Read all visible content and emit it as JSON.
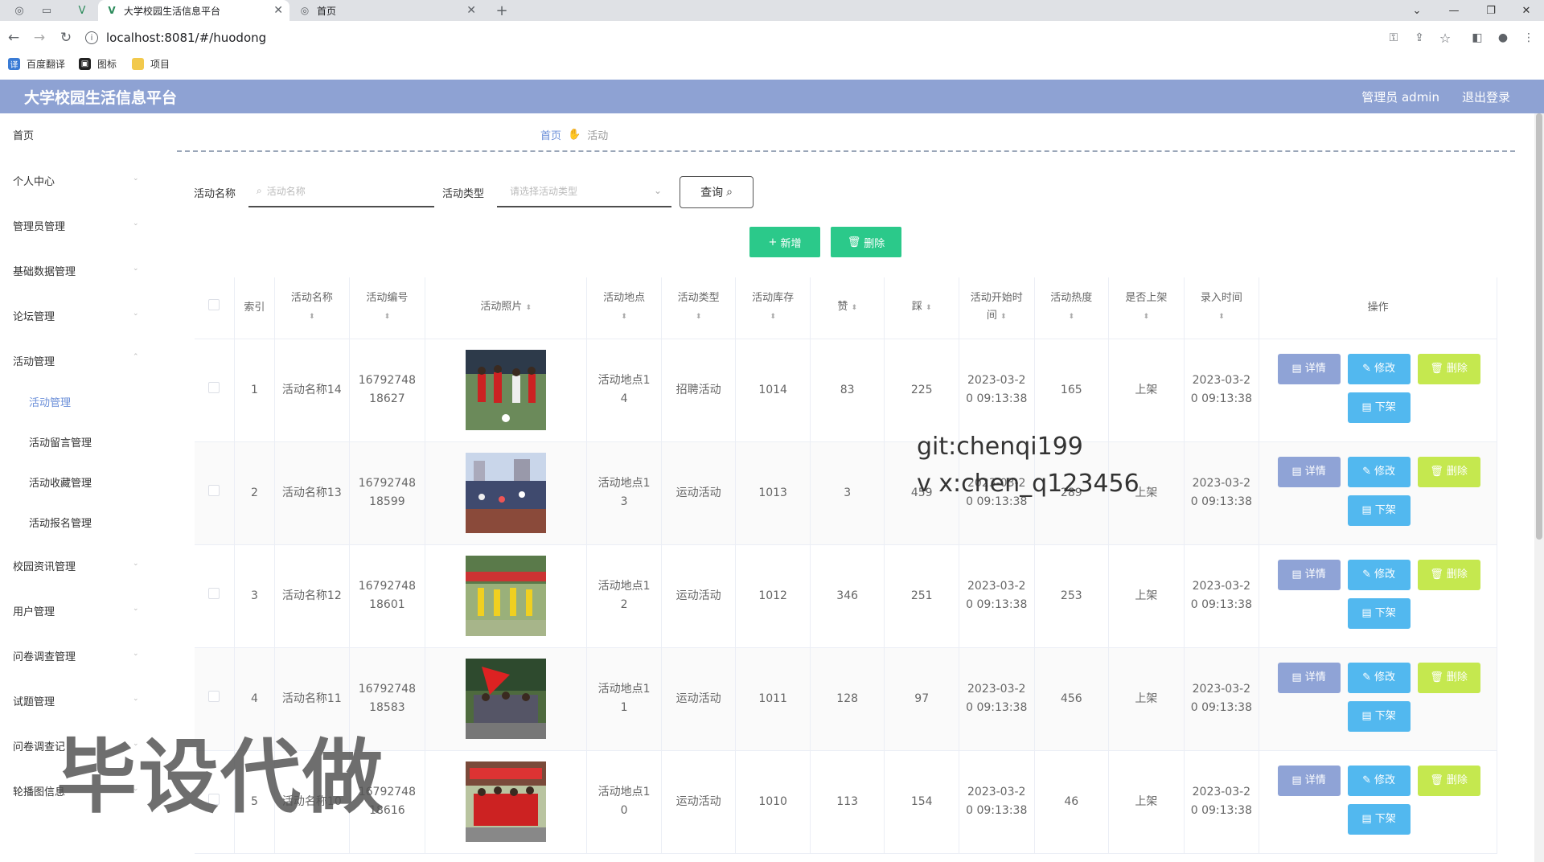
{
  "browser": {
    "tabs": [
      {
        "title": "大学校园生活信息平台"
      },
      {
        "title": "首页"
      }
    ],
    "url": "localhost:8081/#/huodong",
    "bookmarks": [
      "百度翻译",
      "图标",
      "项目"
    ]
  },
  "header": {
    "title": "大学校园生活信息平台",
    "admin": "管理员 admin",
    "logout": "退出登录"
  },
  "sidebar": {
    "items": [
      {
        "label": "首页"
      },
      {
        "label": "个人中心"
      },
      {
        "label": "管理员管理"
      },
      {
        "label": "基础数据管理"
      },
      {
        "label": "论坛管理"
      },
      {
        "label": "活动管理"
      },
      {
        "label": "校园资讯管理"
      },
      {
        "label": "用户管理"
      },
      {
        "label": "问卷调查管理"
      },
      {
        "label": "试题管理"
      },
      {
        "label": "问卷调查记"
      },
      {
        "label": "轮播图信息"
      }
    ],
    "subitems": [
      {
        "label": "活动管理"
      },
      {
        "label": "活动留言管理"
      },
      {
        "label": "活动收藏管理"
      },
      {
        "label": "活动报名管理"
      }
    ]
  },
  "breadcrumb": {
    "home": "首页",
    "current": "活动"
  },
  "filters": {
    "name_label": "活动名称",
    "name_placeholder": "活动名称",
    "type_label": "活动类型",
    "type_placeholder": "请选择活动类型",
    "query": "查询"
  },
  "actions": {
    "add": "新增",
    "delete": "删除"
  },
  "table": {
    "headers": {
      "index": "索引",
      "name": "活动名称",
      "code": "活动编号",
      "photo": "活动照片",
      "place": "活动地点",
      "type": "活动类型",
      "stock": "活动库存",
      "like": "赞",
      "dislike": "踩",
      "start_a": "活动开始时",
      "start_b": "间",
      "hot": "活动热度",
      "shelf": "是否上架",
      "entry": "录入时间",
      "ops": "操作"
    },
    "op_labels": {
      "detail": "详情",
      "edit": "修改",
      "delete": "删除",
      "off": "下架"
    },
    "rows": [
      {
        "index": "1",
        "name": "活动名称14",
        "code_a": "16792748",
        "code_b": "18627",
        "place_a": "活动地点1",
        "place_b": "4",
        "type": "招聘活动",
        "stock": "1014",
        "like": "83",
        "dislike": "225",
        "start_a": "2023-03-2",
        "start_b": "0 09:13:38",
        "hot": "165",
        "shelf": "上架",
        "entry_a": "2023-03-2",
        "entry_b": "0 09:13:38"
      },
      {
        "index": "2",
        "name": "活动名称13",
        "code_a": "16792748",
        "code_b": "18599",
        "place_a": "活动地点1",
        "place_b": "3",
        "type": "运动活动",
        "stock": "1013",
        "like": "3",
        "dislike": "459",
        "start_a": "2023-03-2",
        "start_b": "0 09:13:38",
        "hot": "289",
        "shelf": "上架",
        "entry_a": "2023-03-2",
        "entry_b": "0 09:13:38"
      },
      {
        "index": "3",
        "name": "活动名称12",
        "code_a": "16792748",
        "code_b": "18601",
        "place_a": "活动地点1",
        "place_b": "2",
        "type": "运动活动",
        "stock": "1012",
        "like": "346",
        "dislike": "251",
        "start_a": "2023-03-2",
        "start_b": "0 09:13:38",
        "hot": "253",
        "shelf": "上架",
        "entry_a": "2023-03-2",
        "entry_b": "0 09:13:38"
      },
      {
        "index": "4",
        "name": "活动名称11",
        "code_a": "16792748",
        "code_b": "18583",
        "place_a": "活动地点1",
        "place_b": "1",
        "type": "运动活动",
        "stock": "1011",
        "like": "128",
        "dislike": "97",
        "start_a": "2023-03-2",
        "start_b": "0 09:13:38",
        "hot": "456",
        "shelf": "上架",
        "entry_a": "2023-03-2",
        "entry_b": "0 09:13:38"
      },
      {
        "index": "5",
        "name": "活动名称10",
        "code_a": "16792748",
        "code_b": "18616",
        "place_a": "活动地点1",
        "place_b": "0",
        "type": "运动活动",
        "stock": "1010",
        "like": "113",
        "dislike": "154",
        "start_a": "2023-03-2",
        "start_b": "0 09:13:38",
        "hot": "46",
        "shelf": "上架",
        "entry_a": "2023-03-2",
        "entry_b": "0 09:13:38"
      }
    ]
  },
  "watermarks": {
    "line1": "git:chenqi199",
    "line2": "v x:chen_q123456",
    "big": "毕设代做"
  },
  "colors": {
    "header": "#8ea2d3",
    "accent": "#6a8ed8",
    "add_button": "#2bc98a",
    "detail": "#8fa3d6",
    "edit": "#52b8ef",
    "delete": "#c5e84f"
  }
}
